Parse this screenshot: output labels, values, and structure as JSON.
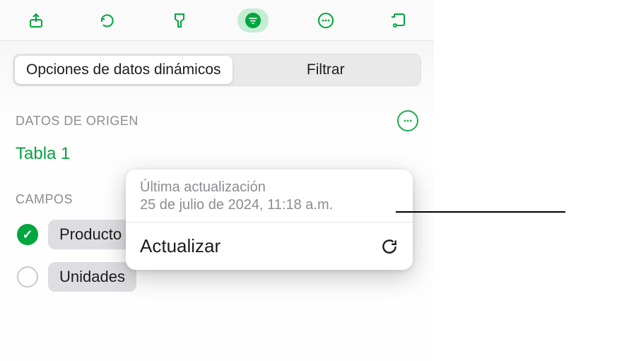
{
  "toolbar": {
    "icons": [
      "share-icon",
      "undo-icon",
      "format-brush-icon",
      "organize-icon",
      "more-icon",
      "pivot-activity-icon"
    ],
    "active_index": 3
  },
  "segmented": {
    "options": [
      "Opciones de datos dinámicos",
      "Filtrar"
    ],
    "selected_index": 0
  },
  "source": {
    "section_title": "DATOS DE ORIGEN",
    "table_name": "Tabla 1"
  },
  "fields": {
    "section_title": "CAMPOS",
    "items": [
      {
        "label": "Producto",
        "checked": true
      },
      {
        "label": "Unidades",
        "checked": false
      }
    ]
  },
  "popover": {
    "title": "Última actualización",
    "timestamp": "25 de julio de 2024, 11:18 a.m.",
    "action_label": "Actualizar"
  }
}
